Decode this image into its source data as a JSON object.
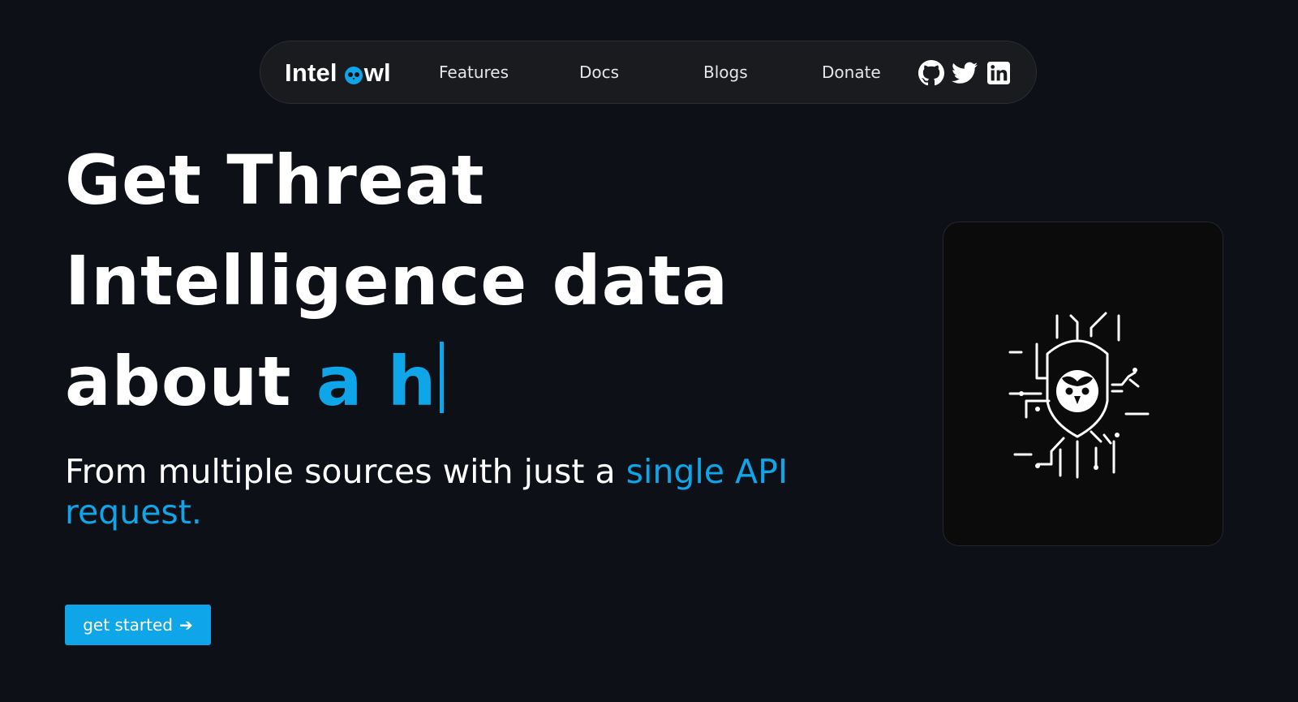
{
  "nav": {
    "logo_text_left": "Intel",
    "logo_text_right": "wl",
    "logo_icon": "owl-icon",
    "links": [
      "Features",
      "Docs",
      "Blogs",
      "Donate"
    ],
    "social_icons": [
      "github-icon",
      "twitter-icon",
      "linkedin-icon"
    ]
  },
  "hero": {
    "title_line1": "Get Threat",
    "title_line2": "Intelligence data",
    "title_line3_prefix": "about ",
    "title_line3_typed": "a h",
    "subtitle_prefix": "From multiple sources with just a ",
    "subtitle_accent": "single API request."
  },
  "cta": {
    "label": "get started",
    "arrow": "➔"
  },
  "card": {
    "icon": "shield-owl-circuit-icon"
  },
  "colors": {
    "background": "#0d1017",
    "nav_background": "#1a1b1f",
    "accent": "#0ea5e9",
    "card_background": "#0b0b0c"
  }
}
